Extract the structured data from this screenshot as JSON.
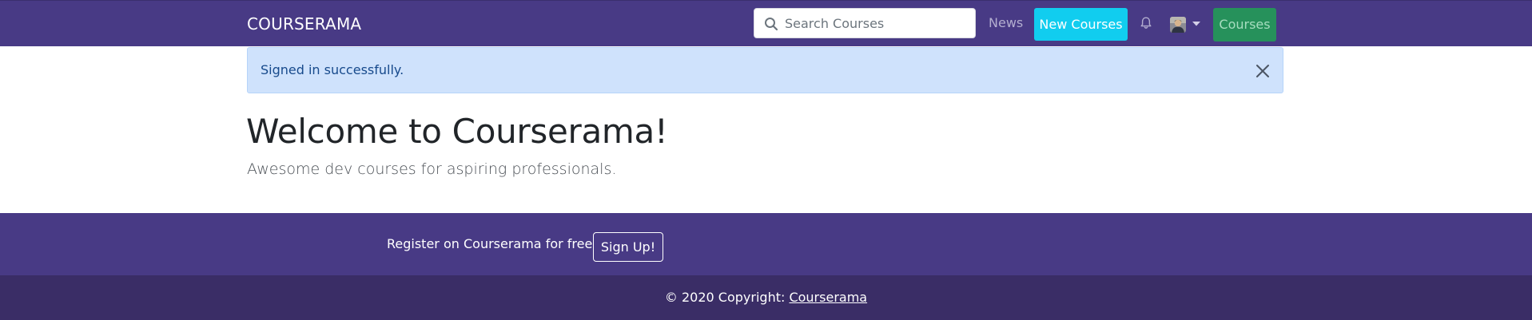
{
  "navbar": {
    "brand": "COURSERAMA",
    "search": {
      "placeholder": "Search Courses",
      "value": "",
      "icon": "search-icon"
    },
    "news_label": "News",
    "new_courses_label": "New Courses",
    "notifications_icon": "bell-icon",
    "user_menu_icon": "avatar",
    "courses_label": "Courses",
    "colors": {
      "background": "#483a85",
      "new_courses_bg": "#11cdef",
      "courses_bg": "#26915b"
    }
  },
  "alert": {
    "message": "Signed in successfully.",
    "close_icon": "close-icon",
    "background": "#cfe2fc"
  },
  "hero": {
    "title": "Welcome to Courserama!",
    "subtitle": "Awesome dev courses for aspiring professionals."
  },
  "footer": {
    "register_text": "Register on Courserama for free",
    "signup_label": "Sign Up!",
    "copyright_prefix": "© 2020 Copyright: ",
    "copyright_link": "Courserama",
    "colors": {
      "top": "#483a85",
      "bottom": "#3a2d66"
    }
  }
}
